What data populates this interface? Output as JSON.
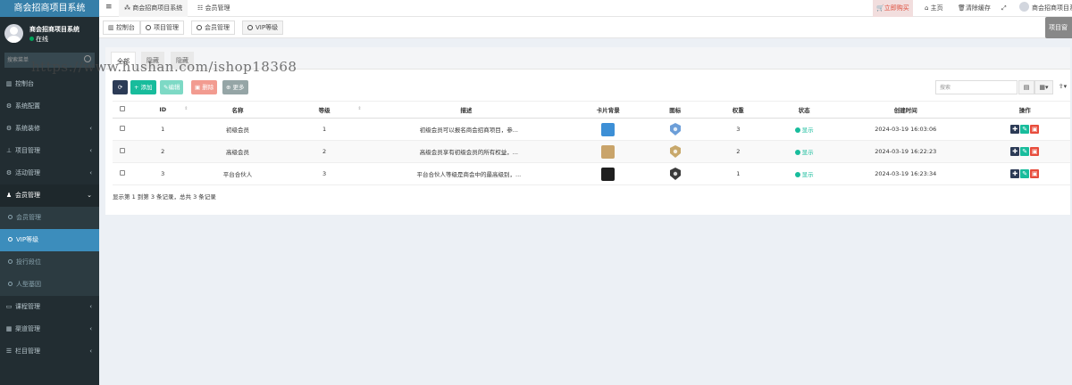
{
  "app": {
    "title": "商会招商项目系统"
  },
  "user": {
    "name": "商会招商项目系统",
    "status": "在线"
  },
  "sidebar": {
    "search_placeholder": "搜索菜单",
    "items": [
      {
        "label": "控制台",
        "icon": "dashboard-icon",
        "has_children": false
      },
      {
        "label": "系统配置",
        "icon": "gears-icon",
        "has_children": false
      },
      {
        "label": "系统装修",
        "icon": "gear-icon",
        "has_children": true
      },
      {
        "label": "项目管理",
        "icon": "sitemap-icon",
        "has_children": true
      },
      {
        "label": "活动管理",
        "icon": "gear-icon",
        "has_children": true
      },
      {
        "label": "会员管理",
        "icon": "user-icon",
        "has_children": true,
        "open": true
      }
    ],
    "sub_items": [
      {
        "label": "会员管理",
        "active": false
      },
      {
        "label": "VIP等级",
        "active": true
      },
      {
        "label": "投行段位",
        "active": false
      },
      {
        "label": "人型基因",
        "active": false
      }
    ],
    "bottom_items": [
      {
        "label": "课程管理",
        "icon": "keyboard-icon",
        "has_children": true
      },
      {
        "label": "渠道管理",
        "icon": "grid-icon",
        "has_children": true
      },
      {
        "label": "栏目管理",
        "icon": "list-icon",
        "has_children": true
      }
    ]
  },
  "header": {
    "tabs": [
      {
        "label": "商会招商项目系统",
        "icon": "sitemap-icon",
        "active": true
      },
      {
        "label": "会员管理",
        "icon": "list-icon",
        "active": false
      }
    ],
    "buy_label": "立即购买",
    "home_label": "主页",
    "clear_cache_label": "清除缓存",
    "user_label": "商会招商项目系统"
  },
  "page_tabs": [
    {
      "label": "控制台",
      "icon": "dashboard-icon",
      "active": false
    },
    {
      "label": "项目管理",
      "icon": "circle-icon",
      "active": false
    },
    {
      "label": "会员管理",
      "icon": "circle-icon",
      "active": false
    },
    {
      "label": "VIP等级",
      "icon": "circle-icon",
      "active": true
    }
  ],
  "right_widget": {
    "label": "项目窗"
  },
  "watermark": "https://www.hushan.com/ishop18368",
  "filter_tabs": [
    {
      "label": "全部",
      "active": true
    },
    {
      "label": "隐藏",
      "active": false
    },
    {
      "label": "隐藏",
      "active": false
    }
  ],
  "toolbar": {
    "add_label": "添加",
    "edit_label": "编辑",
    "delete_label": "删除",
    "more_label": "更多",
    "search_placeholder": "搜索"
  },
  "table": {
    "columns": [
      "ID",
      "名称",
      "等级",
      "描述",
      "卡片背景",
      "图标",
      "权重",
      "状态",
      "创建时间",
      "操作"
    ],
    "rows": [
      {
        "id": "1",
        "name": "初级会员",
        "level": "1",
        "desc": "初级会员可以报名商会招商项目，参...",
        "card_color": "#3d8fd6",
        "icon_color": "#6c9ed8",
        "weight": "3",
        "status": "显示",
        "created": "2024-03-19 16:03:06"
      },
      {
        "id": "2",
        "name": "高级会员",
        "level": "2",
        "desc": "高级会员享有初级会员的所有权益，...",
        "card_color": "#c9a46a",
        "icon_color": "#c8a86b",
        "weight": "2",
        "status": "显示",
        "created": "2024-03-19 16:22:23"
      },
      {
        "id": "3",
        "name": "平台合伙人",
        "level": "3",
        "desc": "平台合伙人等级是商会中的最高级别，...",
        "card_color": "#1f1f1f",
        "icon_color": "#3a3a3a",
        "weight": "1",
        "status": "显示",
        "created": "2024-03-19 16:23:34"
      }
    ]
  },
  "pager": {
    "info": "显示第 1 到第 3 条记录，总共 3 条记录"
  },
  "colors": {
    "sidebar_bg": "#222d32",
    "logo_bg": "#367fa9",
    "active_blue": "#3c8dbc",
    "success": "#18bc9c",
    "danger": "#e74c3c",
    "navy": "#2c3b56"
  }
}
